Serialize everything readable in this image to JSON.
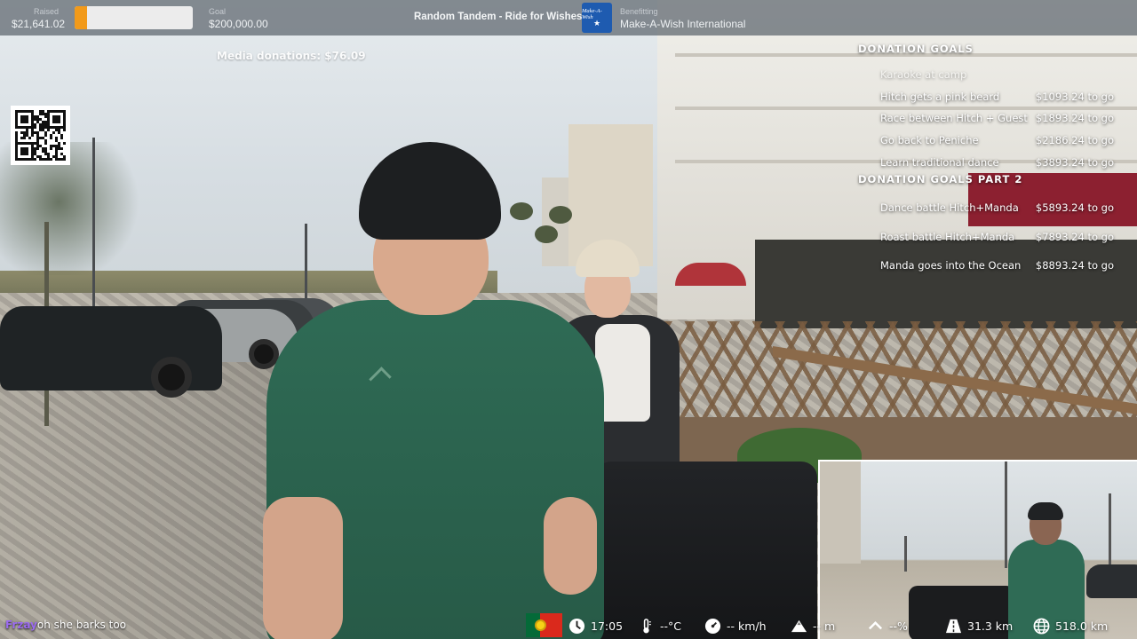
{
  "topbar": {
    "raised_caption": "Raised",
    "raised_value": "$21,641.02",
    "progress_fraction": 0.108,
    "goal_caption": "Goal",
    "goal_value": "$200,000.00",
    "event_title": "Random Tandem - Ride for Wishes",
    "logo_text": "Make-A-Wish",
    "benefitting_caption": "Benefitting",
    "benefitting_value": "Make-A-Wish International",
    "accent_color": "#f29a1a"
  },
  "media_donations": "Media donations: $76.09",
  "goals": {
    "heading_1": "DONATION GOALS",
    "part_1": [
      {
        "name": "Karaoke at camp",
        "amount": "",
        "completed": true
      },
      {
        "name": "Hitch gets a pink beard",
        "amount": "$1093.24 to go",
        "completed": false
      },
      {
        "name": "Race between Hitch + Guest",
        "amount": "$1893.24 to go",
        "completed": false
      },
      {
        "name": "Go back to Peniche",
        "amount": "$2186.24 to go",
        "completed": false
      },
      {
        "name": "Learn traditional dance",
        "amount": "$3893.24 to go",
        "completed": false
      }
    ],
    "heading_2": "DONATION GOALS PART 2",
    "part_2": [
      {
        "name": "Dance battle Hitch+Manda",
        "amount": "$5893.24 to go",
        "completed": false
      },
      {
        "name": "Roast battle Hitch+Manda",
        "amount": "$7893.24 to go",
        "completed": false
      },
      {
        "name": "Manda goes into the Ocean",
        "amount": "$8893.24 to go",
        "completed": false
      }
    ]
  },
  "chat": {
    "username": "Frzay",
    "message": "oh she barks too",
    "username_color": "#9c6cf0"
  },
  "telemetry": {
    "country_flag": "portugal-flag",
    "time": "17:05",
    "temperature": "--°C",
    "speed": "-- km/h",
    "altitude": "-- m",
    "grade": "--%",
    "distance_today": "31.3 km",
    "distance_total": "518.0 km"
  },
  "icons": {
    "clock": "clock-icon",
    "thermometer": "thermometer-icon",
    "speedometer": "speedometer-icon",
    "altitude": "mountain-icon",
    "grade": "chevron-up-icon",
    "distance_today": "road-icon",
    "distance_total": "globe-icon"
  }
}
